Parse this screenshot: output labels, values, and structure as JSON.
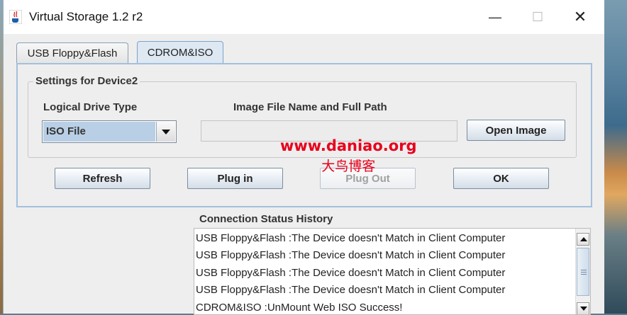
{
  "window": {
    "title": "Virtual Storage 1.2 r2",
    "controls": {
      "minimize": "—",
      "maximize": "☐",
      "close": "✕"
    }
  },
  "tabs": [
    {
      "label": "USB Floppy&Flash",
      "selected": false
    },
    {
      "label": "CDROM&ISO",
      "selected": true
    }
  ],
  "settings": {
    "group_title": "Settings for Device2",
    "drive_type_label": "Logical Drive Type",
    "drive_type_value": "ISO File",
    "image_path_label": "Image File Name and Full Path",
    "image_path_value": "",
    "open_image_button": "Open Image"
  },
  "actions": {
    "refresh": "Refresh",
    "plug_in": "Plug in",
    "plug_out": "Plug Out",
    "ok": "OK"
  },
  "watermark": {
    "url": "www.daniao.org",
    "name": "大鸟博客"
  },
  "history": {
    "title": "Connection Status History",
    "entries": [
      "USB Floppy&Flash :The Device doesn't Match in Client Computer",
      "USB Floppy&Flash :The Device doesn't Match in Client Computer",
      "USB Floppy&Flash :The Device doesn't Match in Client Computer",
      "USB Floppy&Flash :The Device doesn't Match in Client Computer",
      "CDROM&ISO :UnMount Web ISO Success!"
    ]
  },
  "colors": {
    "selected_tab": "#dde8f3",
    "panel_border": "#a3c0dc",
    "combo_selection": "#b8cfe5",
    "watermark": "#e8001c"
  },
  "icons": {
    "app": "java-cup-icon",
    "combo_arrow": "chevron-down-icon",
    "scroll_up": "arrow-up-icon",
    "scroll_down": "arrow-down-icon"
  }
}
